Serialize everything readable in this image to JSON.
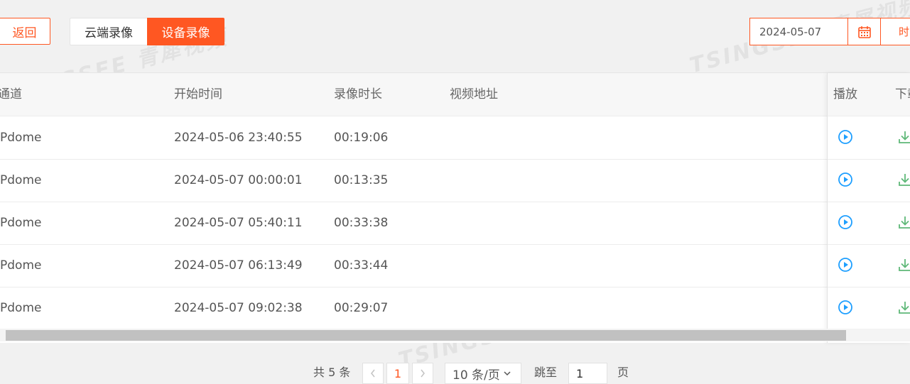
{
  "toolbar": {
    "back_label": "返回",
    "tabs": [
      {
        "label": "云端录像",
        "active": false
      },
      {
        "label": "设备录像",
        "active": true
      }
    ],
    "date_value": "2024-05-07",
    "time_label": "时"
  },
  "table": {
    "columns": [
      "通道",
      "开始时间",
      "录像时长",
      "视频地址",
      "播放",
      "下载"
    ],
    "rows": [
      {
        "channel": "Pdome",
        "start": "2024-05-06 23:40:55",
        "duration": "00:19:06",
        "url": ""
      },
      {
        "channel": "Pdome",
        "start": "2024-05-07 00:00:01",
        "duration": "00:13:35",
        "url": ""
      },
      {
        "channel": "Pdome",
        "start": "2024-05-07 05:40:11",
        "duration": "00:33:38",
        "url": ""
      },
      {
        "channel": "Pdome",
        "start": "2024-05-07 06:13:49",
        "duration": "00:33:44",
        "url": ""
      },
      {
        "channel": "Pdome",
        "start": "2024-05-07 09:02:38",
        "duration": "00:29:07",
        "url": ""
      }
    ]
  },
  "pagination": {
    "total_label": "共 5 条",
    "current_page": "1",
    "page_size_label": "10 条/页",
    "jump_label": "跳至",
    "jump_value": "1",
    "page_suffix": "页"
  },
  "watermark": "TSINGSEE 青犀视频",
  "colors": {
    "accent": "#ff5722",
    "play_icon": "#1e9fff",
    "download_icon": "#5fb878"
  },
  "icons": {
    "calendar": "calendar-icon",
    "play": "play-circle-icon",
    "download": "download-icon",
    "prev": "chevron-left-icon",
    "next": "chevron-right-icon",
    "dropdown": "chevron-down-icon"
  }
}
